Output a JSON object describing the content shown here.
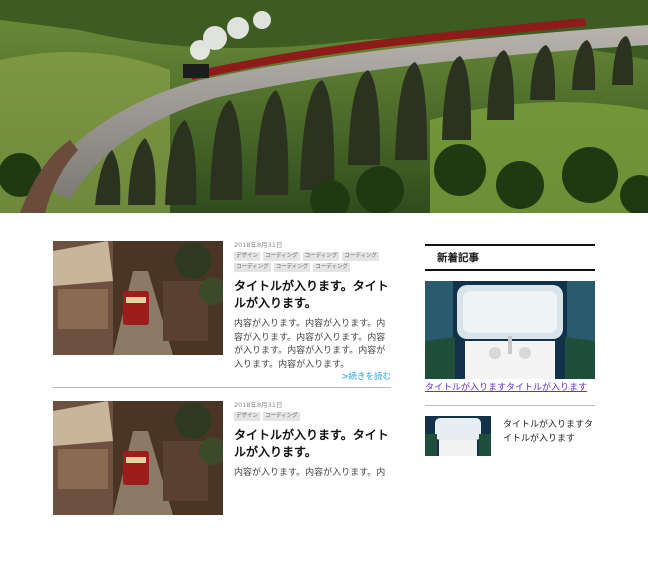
{
  "hero": {
    "alt": "viaduct-train-photo"
  },
  "posts": [
    {
      "date": "2018年8月31日",
      "tags": [
        "デザイン",
        "コーディング",
        "コーディング",
        "コーディング",
        "コーディング",
        "コーディング",
        "コーディング"
      ],
      "title": "タイトルが入ります。タイトルが入ります。",
      "body": "内容が入ります。内容が入ります。内容が入ります。内容が入ります。内容が入ります。内容が入ります。内容が入ります。内容が入ります。",
      "more": ">続きを読む"
    },
    {
      "date": "2018年8月31日",
      "tags": [
        "デザイン",
        "コーディング"
      ],
      "title": "タイトルが入ります。タイトルが入ります。",
      "body": "内容が入ります。内容が入ります。内"
    }
  ],
  "sidebar": {
    "heading": "新着記事",
    "featured_link": "タイトルが入りますタイトルが入ります",
    "item_title": "タイトルが入りますタイトルが入ります"
  },
  "colors": {
    "link": "#1aa3e6",
    "visited": "#6a2fc4"
  }
}
